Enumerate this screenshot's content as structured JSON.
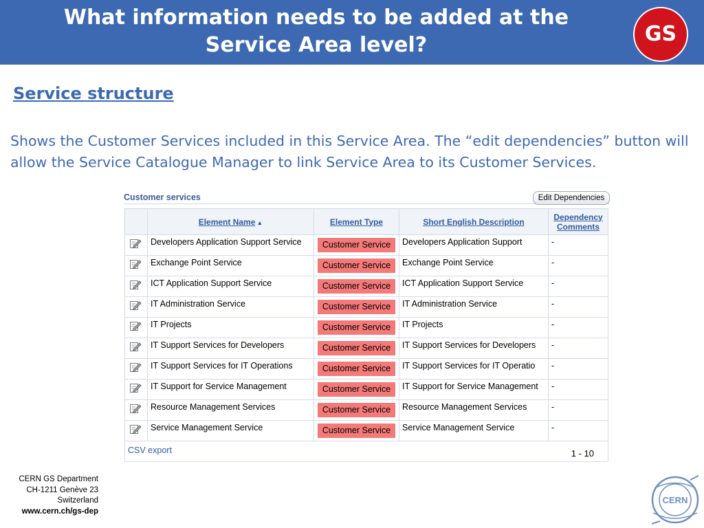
{
  "header": {
    "title_line1": "What information needs to be added at the",
    "title_line2": "Service Area level?",
    "badge": "GS"
  },
  "section_title": "Service structure",
  "intro_text": "Shows the Customer Services included in this Service Area. The “edit dependencies” button will allow the Service Catalogue Manager to link Service Area to its Customer Services.",
  "panel": {
    "title": "Customer services",
    "edit_button": "Edit Dependencies",
    "columns": [
      "Element Name",
      "Element Type",
      "Short English Description",
      "Dependency Comments"
    ],
    "sort_indicator": "▲",
    "rows": [
      {
        "name": "Developers Application Support Service",
        "type": "Customer Service",
        "description": "Developers Application Support",
        "comments": "-"
      },
      {
        "name": "Exchange Point Service",
        "type": "Customer Service",
        "description": "Exchange Point Service",
        "comments": "-"
      },
      {
        "name": "ICT Application Support Service",
        "type": "Customer Service",
        "description": "ICT Application Support Service",
        "comments": "-"
      },
      {
        "name": "IT Administration Service",
        "type": "Customer Service",
        "description": "IT Administration Service",
        "comments": "-"
      },
      {
        "name": "IT Projects",
        "type": "Customer Service",
        "description": "IT Projects",
        "comments": "-"
      },
      {
        "name": "IT Support Services for Developers",
        "type": "Customer Service",
        "description": "IT Support Services for Developers",
        "comments": "-"
      },
      {
        "name": "IT Support Services for IT Operations",
        "type": "Customer Service",
        "description": "IT Support Services for IT Operatio",
        "comments": "-"
      },
      {
        "name": "IT Support for Service Management",
        "type": "Customer Service",
        "description": "IT Support for Service Management",
        "comments": "-"
      },
      {
        "name": "Resource Management Services",
        "type": "Customer Service",
        "description": "Resource Management Services",
        "comments": "-"
      },
      {
        "name": "Service Management Service",
        "type": "Customer Service",
        "description": "Service Management Service",
        "comments": "-"
      }
    ],
    "csv_export": "CSV export",
    "pagination": "1 - 10"
  },
  "footer": {
    "line1": "CERN GS Department",
    "line2": "CH-1211 Genève 23",
    "line3": "Switzerland",
    "url": "www.cern.ch/gs-dep"
  },
  "logo": {
    "text": "CERN"
  },
  "colors": {
    "header_bg": "#3d69b2",
    "badge_bg": "#d0141e",
    "accent_text": "#3d69b2",
    "type_tag_bg": "#f37a78"
  },
  "icons": {
    "row_action": "edit-pencil-icon"
  }
}
